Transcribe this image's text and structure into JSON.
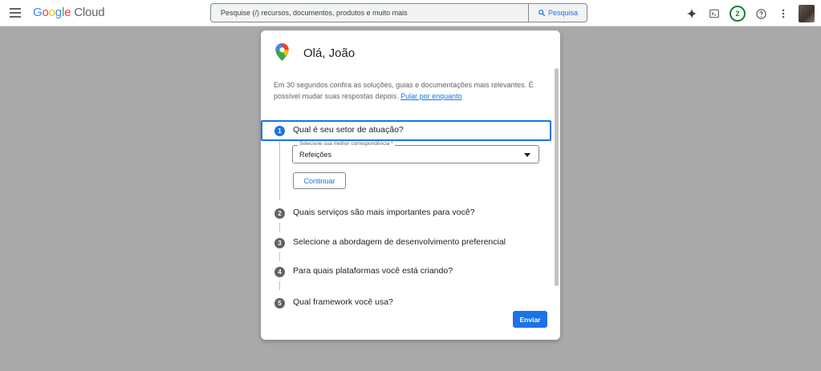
{
  "header": {
    "logo_google": [
      "G",
      "o",
      "o",
      "g",
      "l",
      "e"
    ],
    "logo_cloud": "Cloud",
    "search_placeholder": "Pesquise (/) recursos, documentos, produtos e muito mais",
    "search_button": "Pesquisa",
    "notification_count": "2"
  },
  "dialog": {
    "greeting": "Olá, João",
    "intro": "Em 30 segundos confira as soluções, guias e documentações mais relevantes. É possível mudar suas respostas depois.",
    "skip_link": "Pular por enquanto",
    "steps": [
      {
        "num": "1",
        "title": "Qual é seu setor de atuação?"
      },
      {
        "num": "2",
        "title": "Quais serviços são mais importantes para você?"
      },
      {
        "num": "3",
        "title": "Selecione a abordagem de desenvolvimento preferencial"
      },
      {
        "num": "4",
        "title": "Para quais plataformas você está criando?"
      },
      {
        "num": "5",
        "title": "Qual framework você usa?"
      }
    ],
    "select_label": "Selecione sua melhor correspondência *",
    "select_value": "Refeições",
    "continue_button": "Continuar",
    "send_button": "Enviar"
  },
  "colors": {
    "accent": "#1a73e8",
    "badge": "#188038",
    "overlay": "#a9a9a9"
  }
}
